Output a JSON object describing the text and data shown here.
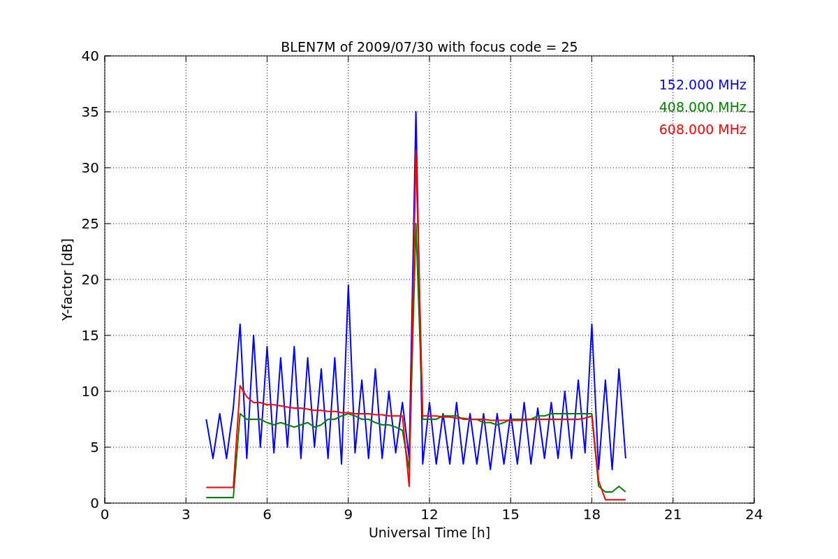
{
  "chart_data": {
    "type": "line",
    "title": "BLEN7M of 2009/07/30 with focus code = 25",
    "xlabel": "Universal Time [h]",
    "ylabel": "Y-factor [dB]",
    "x": [
      3.75,
      4,
      4.25,
      4.5,
      4.75,
      5,
      5.25,
      5.5,
      5.75,
      6,
      6.25,
      6.5,
      6.75,
      7,
      7.25,
      7.5,
      7.75,
      8,
      8.25,
      8.5,
      8.75,
      9,
      9.25,
      9.5,
      9.75,
      10,
      10.25,
      10.5,
      10.75,
      11,
      11.25,
      11.5,
      11.75,
      12,
      12.25,
      12.5,
      12.75,
      13,
      13.25,
      13.5,
      13.75,
      14,
      14.25,
      14.5,
      14.75,
      15,
      15.25,
      15.5,
      15.75,
      16,
      16.25,
      16.5,
      16.75,
      17,
      17.25,
      17.5,
      17.75,
      18,
      18.25,
      18.5,
      18.75,
      19,
      19.25
    ],
    "series": [
      {
        "name": "152.000 MHz",
        "color": "#0000ff",
        "values": [
          7.5,
          4,
          8,
          4,
          8.5,
          16,
          4,
          15,
          5,
          14,
          4.5,
          13,
          5,
          14,
          4,
          13,
          5,
          12,
          4,
          13,
          3.5,
          19.5,
          4.5,
          11,
          4,
          12,
          4,
          10,
          4.5,
          9,
          4,
          35,
          3.5,
          9,
          3.5,
          8,
          3.5,
          9,
          3.5,
          8,
          3.5,
          8,
          3,
          8,
          3.5,
          8,
          3.5,
          9,
          3.5,
          8.5,
          4,
          9,
          4,
          10,
          4,
          11,
          4.5,
          16,
          3,
          11,
          3,
          12,
          4
        ]
      },
      {
        "name": "408.000 MHz",
        "color": "#008000",
        "values": [
          0.5,
          0.5,
          0.5,
          0.5,
          0.5,
          8,
          7.5,
          7.5,
          7.5,
          7.2,
          7,
          7.2,
          7,
          6.8,
          7,
          7.2,
          6.8,
          7,
          7.5,
          7.5,
          7.8,
          8,
          7.8,
          7.5,
          7.5,
          7.2,
          7,
          7,
          6.8,
          6.5,
          3,
          25,
          7.5,
          7.5,
          7.5,
          7.8,
          7.8,
          7.8,
          7.5,
          7.5,
          7.5,
          7.2,
          7.2,
          7,
          7.2,
          7.5,
          7.5,
          7.5,
          7.5,
          7.8,
          7.8,
          8,
          8,
          8,
          8,
          8,
          8,
          8,
          1.5,
          1,
          1,
          1.5,
          1
        ]
      },
      {
        "name": "608.000 MHz",
        "color": "#ff0000",
        "values": [
          1.4,
          1.4,
          1.4,
          1.4,
          1.4,
          10.5,
          9.5,
          9,
          9,
          8.8,
          8.8,
          8.7,
          8.6,
          8.5,
          8.5,
          8.4,
          8.3,
          8.3,
          8.2,
          8.2,
          8.1,
          8.1,
          8,
          8,
          8,
          7.9,
          7.9,
          7.8,
          7.8,
          7.8,
          1.5,
          31.5,
          7.8,
          7.8,
          7.8,
          7.7,
          7.7,
          7.6,
          7.6,
          7.5,
          7.5,
          7.5,
          7.4,
          7.4,
          7.4,
          7.4,
          7.4,
          7.4,
          7.5,
          7.5,
          7.5,
          7.5,
          7.5,
          7.5,
          7.5,
          7.5,
          7.6,
          7.8,
          2,
          0.3,
          0.3,
          0.3,
          0.3
        ]
      }
    ],
    "xlim": [
      0,
      24
    ],
    "ylim": [
      0,
      40
    ],
    "xticks": [
      0,
      3,
      6,
      9,
      12,
      15,
      18,
      21,
      24
    ],
    "yticks": [
      0,
      5,
      10,
      15,
      20,
      25,
      30,
      35,
      40
    ],
    "grid": true
  }
}
